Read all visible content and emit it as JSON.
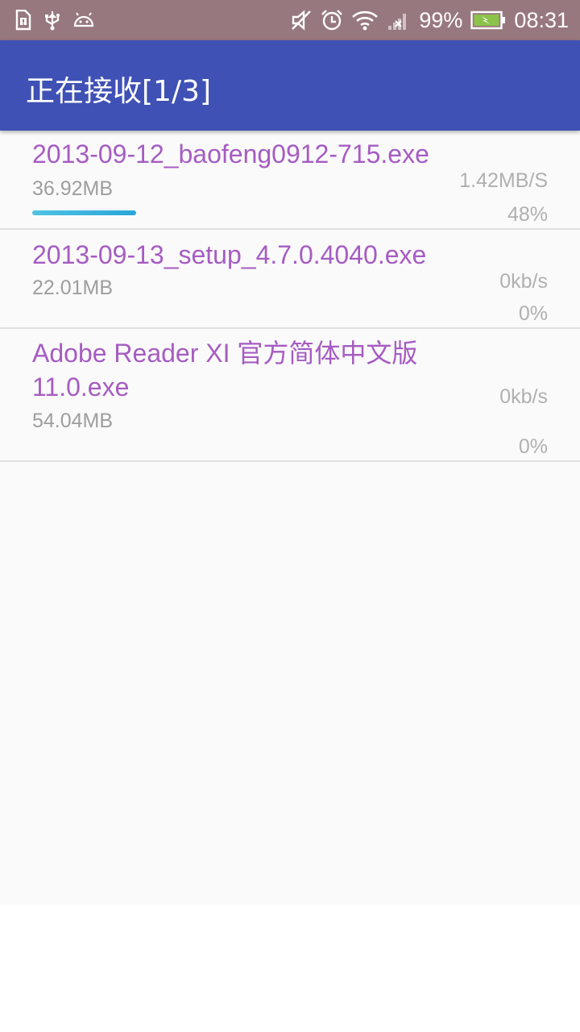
{
  "status_bar": {
    "battery_percent": "99%",
    "time": "08:31",
    "icons": [
      "sim-alert-icon",
      "usb-icon",
      "android-debug-icon",
      "mute-icon",
      "alarm-icon",
      "wifi-icon",
      "no-signal-icon",
      "battery-charging-icon"
    ]
  },
  "app_bar": {
    "title": "正在接收[1/3]"
  },
  "downloads": [
    {
      "name": "2013-09-12_baofeng0912-715.exe",
      "size": "36.92MB",
      "speed": "1.42MB/S",
      "percent": "48%",
      "progress": 0.48
    },
    {
      "name": "2013-09-13_setup_4.7.0.4040.exe",
      "size": "22.01MB",
      "speed": "0kb/s",
      "percent": "0%",
      "progress": 0
    },
    {
      "name": "Adobe Reader XI 官方简体中文版 11.0.exe",
      "size": "54.04MB",
      "speed": "0kb/s",
      "percent": "0%",
      "progress": 0
    }
  ],
  "colors": {
    "status_bar": "#98787f",
    "app_bar": "#3f51b5",
    "file_name": "#a65cc2",
    "progress": "#29a6d9"
  }
}
